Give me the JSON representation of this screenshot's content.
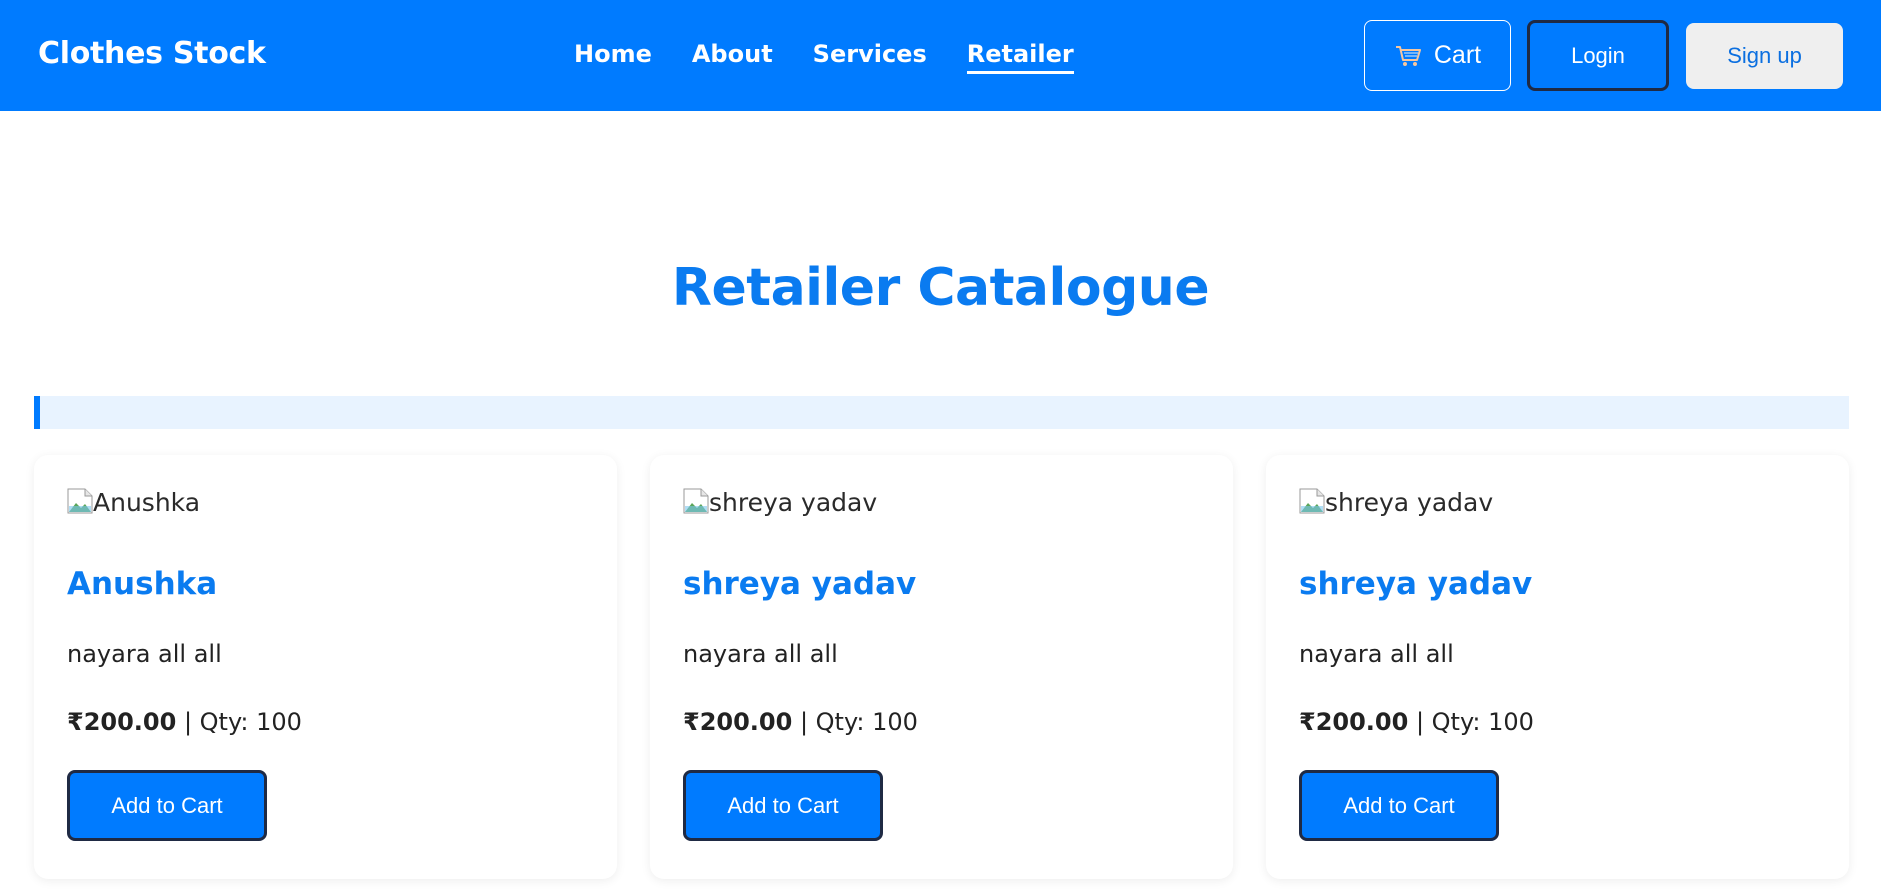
{
  "navbar": {
    "brand": "Clothes Stock",
    "links": [
      {
        "label": "Home",
        "active": false
      },
      {
        "label": "About",
        "active": false
      },
      {
        "label": "Services",
        "active": false
      },
      {
        "label": "Retailer",
        "active": true
      }
    ],
    "cart_label": "Cart",
    "login_label": "Login",
    "signup_label": "Sign up"
  },
  "page": {
    "title": "Retailer Catalogue"
  },
  "products": [
    {
      "image_alt": "Anushka",
      "name": "Anushka",
      "description": "nayara all all",
      "price": "₹200.00",
      "separator": " | ",
      "qty": "Qty: 100",
      "button_label": "Add to Cart"
    },
    {
      "image_alt": "shreya yadav",
      "name": "shreya yadav",
      "description": "nayara all all",
      "price": "₹200.00",
      "separator": " | ",
      "qty": "Qty: 100",
      "button_label": "Add to Cart"
    },
    {
      "image_alt": "shreya yadav",
      "name": "shreya yadav",
      "description": "nayara all all",
      "price": "₹200.00",
      "separator": " | ",
      "qty": "Qty: 100",
      "button_label": "Add to Cart"
    }
  ],
  "colors": {
    "primary": "#007bff",
    "title": "#0a7bf0",
    "info_bar_bg": "#e8f3ff",
    "signup_bg": "#efefef"
  },
  "icons": {
    "cart": "shopping-cart-icon",
    "broken_image": "broken-image-icon"
  }
}
